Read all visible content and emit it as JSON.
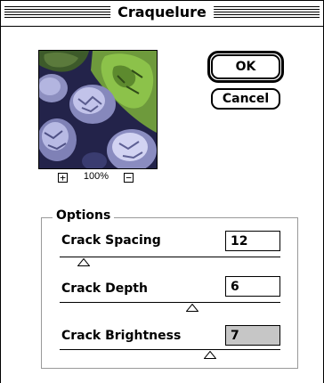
{
  "window": {
    "title": "Craquelure"
  },
  "preview": {
    "zoom_label": "100%",
    "zoom_in_glyph": "+",
    "zoom_out_glyph": "−"
  },
  "buttons": {
    "ok": "OK",
    "cancel": "Cancel"
  },
  "options": {
    "label": "Options",
    "params": [
      {
        "label": "Crack Spacing",
        "value": "12",
        "slider_fraction": 0.11
      },
      {
        "label": "Crack Depth",
        "value": "6",
        "slider_fraction": 0.6
      },
      {
        "label": "Crack Brightness",
        "value": "7",
        "slider_fraction": 0.68,
        "active": true
      }
    ]
  },
  "colors": {
    "field_active_bg": "#c6c6c6"
  }
}
